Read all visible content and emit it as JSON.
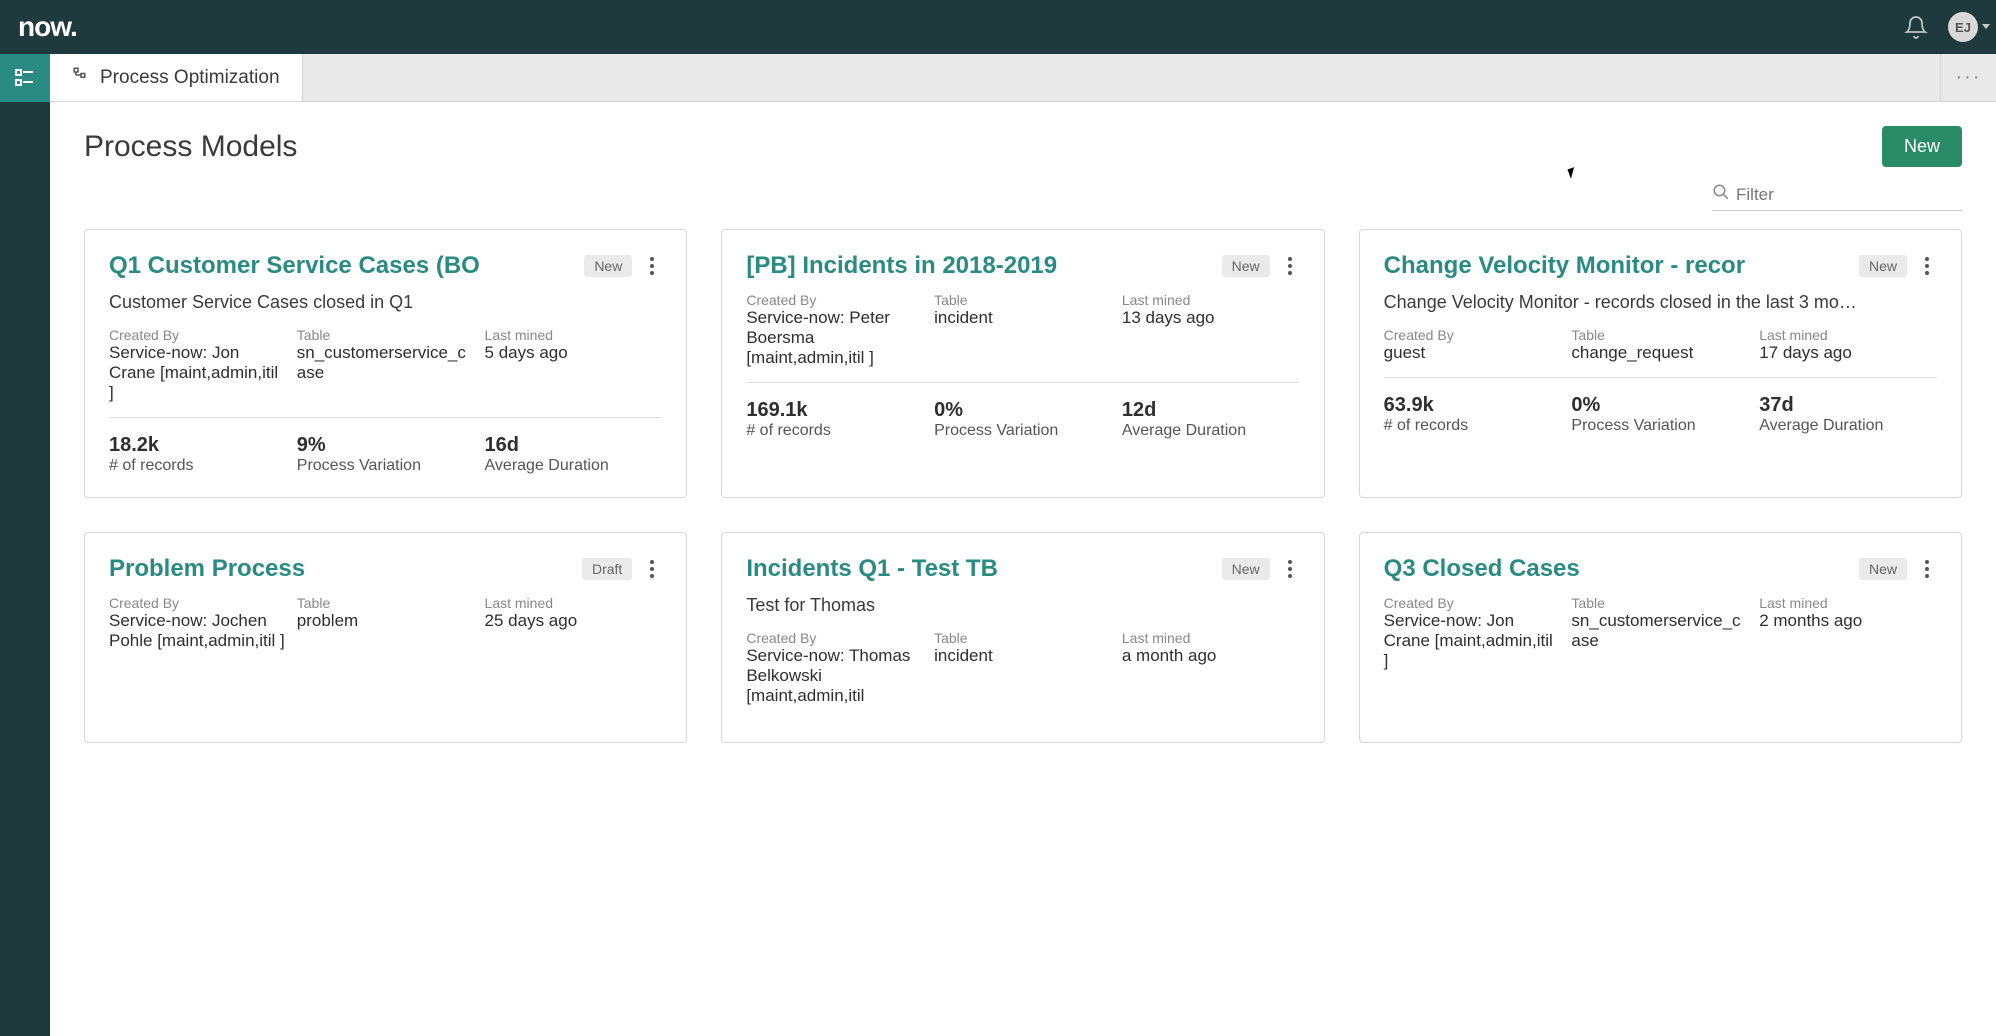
{
  "app": {
    "logo": "now.",
    "avatar_initials": "EJ"
  },
  "tab": {
    "label": "Process Optimization"
  },
  "page": {
    "title": "Process Models",
    "new_button": "New",
    "filter_placeholder": "Filter"
  },
  "meta_labels": {
    "created_by": "Created By",
    "table": "Table",
    "last_mined": "Last mined"
  },
  "stat_labels": {
    "records": "# of records",
    "variation": "Process Variation",
    "duration": "Average Duration"
  },
  "cards": [
    {
      "title": "Q1 Customer Service Cases (BO",
      "badge": "New",
      "desc": "Customer Service Cases closed in Q1",
      "created_by": "Service-now: Jon Crane [maint,admin,itil ]",
      "table": "sn_customerservice_case",
      "last_mined": "5 days ago",
      "records": "18.2k",
      "variation": "9%",
      "duration": "16d"
    },
    {
      "title": "[PB] Incidents in 2018-2019",
      "badge": "New",
      "desc": "",
      "created_by": "Service-now: Peter Boersma [maint,admin,itil ]",
      "table": "incident",
      "last_mined": "13 days ago",
      "records": "169.1k",
      "variation": "0%",
      "duration": "12d"
    },
    {
      "title": "Change Velocity Monitor - recor",
      "badge": "New",
      "desc": "Change Velocity Monitor - records closed in the last 3 mo…",
      "created_by": "guest",
      "table": "change_request",
      "last_mined": "17 days ago",
      "records": "63.9k",
      "variation": "0%",
      "duration": "37d"
    },
    {
      "title": "Problem Process",
      "badge": "Draft",
      "desc": "",
      "created_by": "Service-now: Jochen Pohle [maint,admin,itil ]",
      "table": "problem",
      "last_mined": "25 days ago",
      "records": "",
      "variation": "",
      "duration": ""
    },
    {
      "title": "Incidents Q1 - Test TB",
      "badge": "New",
      "desc": "Test for Thomas",
      "created_by": "Service-now: Thomas Belkowski [maint,admin,itil",
      "table": "incident",
      "last_mined": "a month ago",
      "records": "",
      "variation": "",
      "duration": ""
    },
    {
      "title": "Q3 Closed Cases",
      "badge": "New",
      "desc": "",
      "created_by": "Service-now: Jon Crane [maint,admin,itil ]",
      "table": "sn_customerservice_case",
      "last_mined": "2 months ago",
      "records": "",
      "variation": "",
      "duration": ""
    }
  ]
}
